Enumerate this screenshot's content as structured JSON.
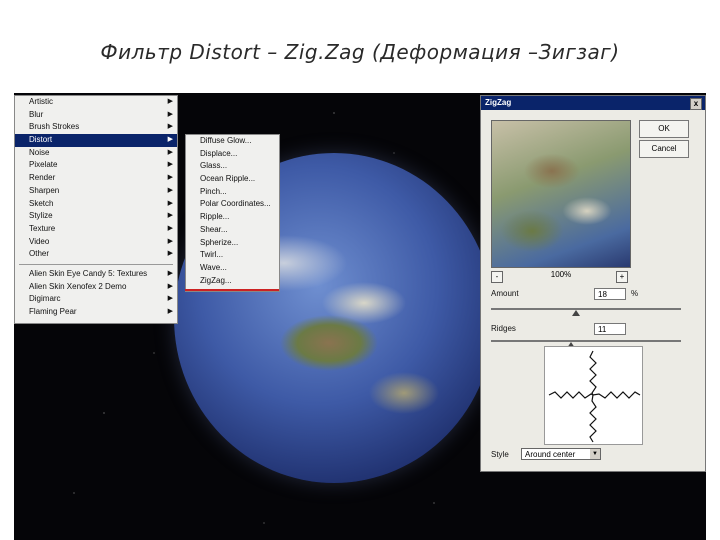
{
  "slide": {
    "title": "Фильтр Distort – Zig.Zag (Деформация –Зигзаг)"
  },
  "filter_menu": {
    "items": [
      {
        "label": "Artistic",
        "has_submenu": true
      },
      {
        "label": "Blur",
        "has_submenu": true
      },
      {
        "label": "Brush Strokes",
        "has_submenu": true
      },
      {
        "label": "Distort",
        "has_submenu": true,
        "selected": true
      },
      {
        "label": "Noise",
        "has_submenu": true
      },
      {
        "label": "Pixelate",
        "has_submenu": true
      },
      {
        "label": "Render",
        "has_submenu": true
      },
      {
        "label": "Sharpen",
        "has_submenu": true
      },
      {
        "label": "Sketch",
        "has_submenu": true
      },
      {
        "label": "Stylize",
        "has_submenu": true
      },
      {
        "label": "Texture",
        "has_submenu": true
      },
      {
        "label": "Video",
        "has_submenu": true
      },
      {
        "label": "Other",
        "has_submenu": true
      }
    ],
    "plugin_items": [
      {
        "label": "Alien Skin Eye Candy 5: Textures",
        "has_submenu": true
      },
      {
        "label": "Alien Skin Xenofex 2 Demo",
        "has_submenu": true
      },
      {
        "label": "Digimarc",
        "has_submenu": true
      },
      {
        "label": "Flaming Pear",
        "has_submenu": true
      }
    ]
  },
  "distort_submenu": {
    "items": [
      "Diffuse Glow...",
      "Displace...",
      "Glass...",
      "Ocean Ripple...",
      "Pinch...",
      "Polar Coordinates...",
      "Ripple...",
      "Shear...",
      "Spherize...",
      "Twirl...",
      "Wave...",
      "ZigZag..."
    ]
  },
  "dialog": {
    "title": "ZigZag",
    "close": "x",
    "ok_label": "OK",
    "cancel_label": "Cancel",
    "zoom": "100%",
    "zoom_minus": "-",
    "zoom_plus": "+",
    "amount_label": "Amount",
    "amount_value": "18",
    "amount_unit": "%",
    "ridges_label": "Ridges",
    "ridges_value": "11",
    "style_label": "Style",
    "style_value": "Around center"
  }
}
